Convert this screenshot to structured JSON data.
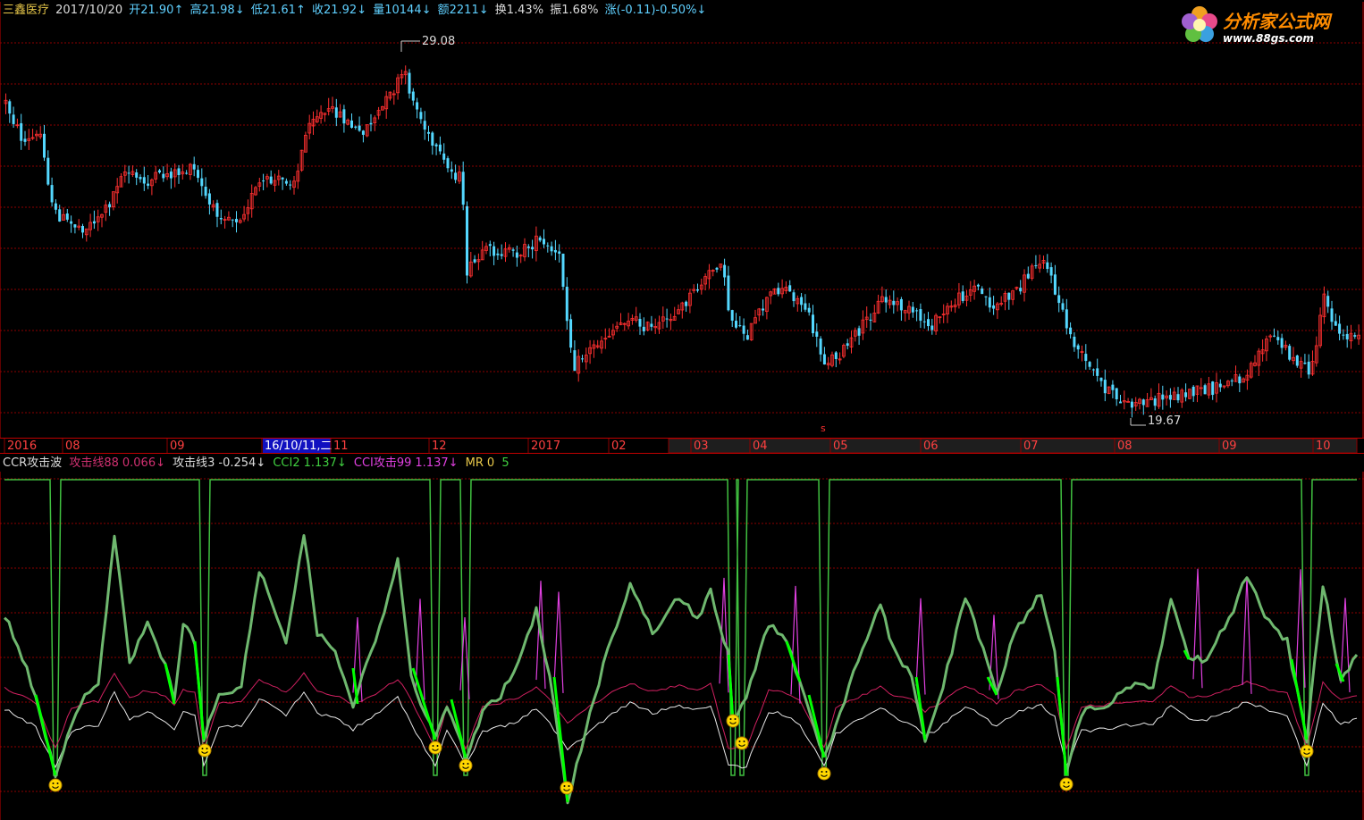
{
  "stock": {
    "name": "三鑫医疗",
    "date": "2017/10/20",
    "open": "开21.90↑",
    "high": "高21.98↓",
    "low": "低21.61↑",
    "close": "收21.92↓",
    "volume": "量10144↓",
    "amount": "额2211↓",
    "turnover": "换1.43%",
    "amplitude": "振1.68%",
    "change": "涨(-0.11)-0.50%↓"
  },
  "logo": {
    "name": "分析家公式网",
    "url": "www.88gs.com"
  },
  "price_chart": {
    "high_label": "29.08",
    "low_label": "19.67",
    "marker": "s"
  },
  "time_axis": {
    "labels": [
      "2016",
      "08",
      "09",
      "16/10/11,二",
      "11",
      "12",
      "2017",
      "02",
      "03",
      "04",
      "05",
      "06",
      "07",
      "08",
      "09",
      "10"
    ]
  },
  "indicator": {
    "name": "CCR攻击波",
    "line88_label": "攻击线88",
    "line88_value": "0.066↓",
    "line3_label": "攻击线3",
    "line3_value": "-0.254↓",
    "cci2_label": "CCI2",
    "cci2_value": "1.137↓",
    "cci99_label": "CCI攻击99",
    "cci99_value": "1.137↓",
    "mr_label": "MR",
    "mr_value": "0",
    "extra_value": "5"
  },
  "colors": {
    "up": "#ff3030",
    "down": "#54d8ff",
    "grid": "#8b0000",
    "green": "#00ff00",
    "olive_green": "#6fb86f",
    "magenta": "#e040e0",
    "pink": "#d02060",
    "smile": "#ffd700"
  },
  "chart_data": [
    {
      "type": "candlestick",
      "title": "三鑫医疗",
      "x_range": [
        "2016-07",
        "2017-10-20"
      ],
      "y_annotations": {
        "max": 29.08,
        "min": 19.67
      },
      "last_bar": {
        "date": "2017/10/20",
        "open": 21.9,
        "high": 21.98,
        "low": 21.61,
        "close": 21.92
      }
    },
    {
      "type": "line",
      "title": "CCR攻击波",
      "series": [
        {
          "name": "攻击线88",
          "last": 0.066
        },
        {
          "name": "攻击线3",
          "last": -0.254
        },
        {
          "name": "CCI2",
          "last": 1.137
        },
        {
          "name": "CCI攻击99",
          "last": 1.137
        },
        {
          "name": "MR",
          "last": 0
        }
      ]
    }
  ]
}
